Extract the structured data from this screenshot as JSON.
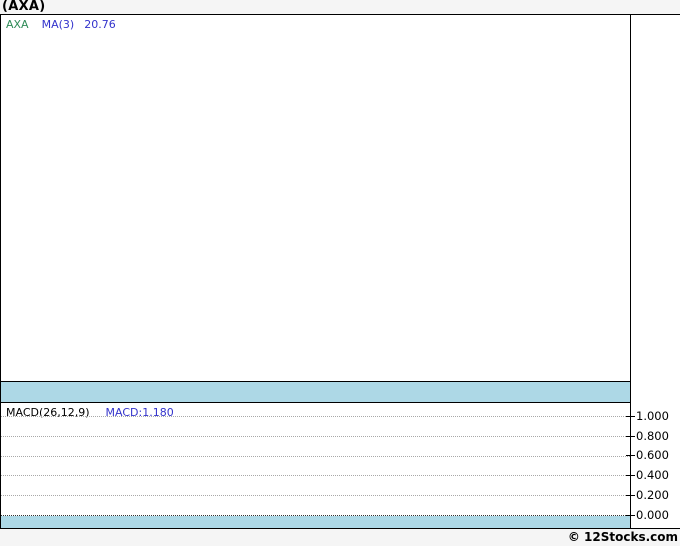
{
  "page": {
    "title": "(AXA)",
    "footer": {
      "copyright": "© 12Stocks.com"
    }
  },
  "price_panel": {
    "legend": {
      "symbol": "AXA",
      "ma_label": "MA(3)",
      "ma_value": "20.76"
    }
  },
  "macd_panel": {
    "legend": {
      "indicator_label": "MACD(26,12,9)",
      "indicator_value": "MACD:1.180"
    },
    "axis_ticks": [
      "1.000",
      "0.800",
      "0.600",
      "0.400",
      "0.200",
      "0.000"
    ]
  },
  "colors": {
    "symbol_green": "#2E8B57",
    "indicator_blue": "#3333CC",
    "highlight_band_blue": "#ADD8E6",
    "border_black": "#000000",
    "gridline_gray": "#A8A8A8",
    "page_background": "#F5F5F5"
  },
  "chart_data": [
    {
      "type": "line",
      "panel": "price",
      "title": "(AXA)",
      "legend_entries": [
        "AXA",
        "MA(3)",
        "20.76"
      ],
      "legend_position": "top-left",
      "grid": false,
      "series": [
        {
          "name": "AXA",
          "values": []
        },
        {
          "name": "MA(3)",
          "last_value": 20.76,
          "values": []
        }
      ],
      "note": "plot area empty in captured frame; no visible data points or axis labels"
    },
    {
      "type": "line",
      "panel": "MACD(26,12,9)",
      "legend_entries": [
        "MACD(26,12,9)",
        "MACD:1.180"
      ],
      "legend_position": "top-left",
      "grid": true,
      "yticks": [
        1.0,
        0.8,
        0.6,
        0.4,
        0.2,
        0.0
      ],
      "ylim": [
        -0.13,
        1.12
      ],
      "series": [
        {
          "name": "MACD",
          "last_value": 1.18,
          "values": []
        }
      ],
      "note": "gridlines visible at each 0.200 step; zero line drawn darker; no visible line data"
    }
  ]
}
